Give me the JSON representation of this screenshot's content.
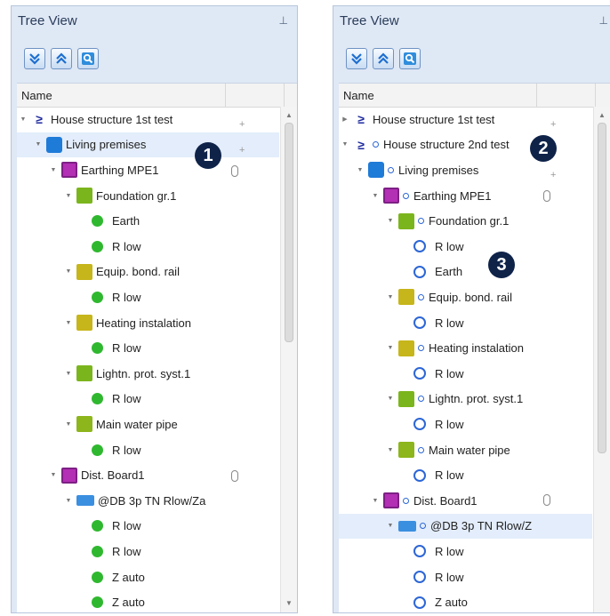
{
  "left": {
    "title": "Tree View",
    "pin": "📌",
    "header": "Name",
    "badge": "1",
    "rows": [
      {
        "label": "House structure 1st test",
        "icon": "house-structure-icon",
        "depth": 0,
        "arrow": "▼"
      },
      {
        "label": "Living premises",
        "icon": "living-premises-icon",
        "depth": 1,
        "arrow": "▼",
        "selected": true
      },
      {
        "label": "Earthing MPE1",
        "icon": "earthing-icon",
        "depth": 2,
        "arrow": "▼"
      },
      {
        "label": "Foundation gr.1",
        "icon": "foundation-icon",
        "depth": 3,
        "arrow": "▼"
      },
      {
        "label": "Earth",
        "icon": "green-dot-icon",
        "depth": 4
      },
      {
        "label": "R low",
        "icon": "green-dot-icon",
        "depth": 4
      },
      {
        "label": "Equip. bond. rail",
        "icon": "bonding-icon",
        "depth": 3,
        "arrow": "▼"
      },
      {
        "label": "R low",
        "icon": "green-dot-icon",
        "depth": 4
      },
      {
        "label": "Heating instalation",
        "icon": "heating-icon",
        "depth": 3,
        "arrow": "▼"
      },
      {
        "label": "R low",
        "icon": "green-dot-icon",
        "depth": 4
      },
      {
        "label": "Lightn. prot. syst.1",
        "icon": "lightning-icon",
        "depth": 3,
        "arrow": "▼"
      },
      {
        "label": "R low",
        "icon": "green-dot-icon",
        "depth": 4
      },
      {
        "label": "Main water pipe",
        "icon": "water-pipe-icon",
        "depth": 3,
        "arrow": "▼"
      },
      {
        "label": "R low",
        "icon": "green-dot-icon",
        "depth": 4
      },
      {
        "label": "Dist. Board1",
        "icon": "dist-board-icon",
        "depth": 2,
        "arrow": "▼"
      },
      {
        "label": "@DB 3p TN Rlow/Za",
        "icon": "db-icon",
        "depth": 3,
        "arrow": "▼"
      },
      {
        "label": "R low",
        "icon": "green-dot-icon",
        "depth": 4
      },
      {
        "label": "R low",
        "icon": "green-dot-icon",
        "depth": 4
      },
      {
        "label": "Z auto",
        "icon": "green-dot-icon",
        "depth": 4
      },
      {
        "label": "Z auto",
        "icon": "green-dot-icon",
        "depth": 4
      }
    ]
  },
  "right": {
    "title": "Tree View",
    "pin": "📌",
    "header": "Name",
    "badge2": "2",
    "badge3": "3",
    "rows": [
      {
        "label": "House structure 1st test",
        "icon": "house-structure-icon",
        "depth": 0,
        "arrow": "▶"
      },
      {
        "label": "House structure 2nd test",
        "icon": "house-structure-icon",
        "depth": 0,
        "arrow": "▼",
        "ring": true
      },
      {
        "label": "Living premises",
        "icon": "living-premises-icon",
        "depth": 1,
        "arrow": "▼",
        "ring": true
      },
      {
        "label": "Earthing MPE1",
        "icon": "earthing-icon",
        "depth": 2,
        "arrow": "▼",
        "ring": true
      },
      {
        "label": "Foundation gr.1",
        "icon": "foundation-icon",
        "depth": 3,
        "arrow": "▼",
        "ring": true
      },
      {
        "label": "R low",
        "icon": "blue-ring-icon",
        "depth": 4
      },
      {
        "label": "Earth",
        "icon": "blue-ring-icon",
        "depth": 4
      },
      {
        "label": "Equip. bond. rail",
        "icon": "bonding-icon",
        "depth": 3,
        "arrow": "▼",
        "ring": true
      },
      {
        "label": "R low",
        "icon": "blue-ring-icon",
        "depth": 4
      },
      {
        "label": "Heating instalation",
        "icon": "heating-icon",
        "depth": 3,
        "arrow": "▼",
        "ring": true
      },
      {
        "label": "R low",
        "icon": "blue-ring-icon",
        "depth": 4
      },
      {
        "label": "Lightn. prot. syst.1",
        "icon": "lightning-icon",
        "depth": 3,
        "arrow": "▼",
        "ring": true
      },
      {
        "label": "R low",
        "icon": "blue-ring-icon",
        "depth": 4
      },
      {
        "label": "Main water pipe",
        "icon": "water-pipe-icon",
        "depth": 3,
        "arrow": "▼",
        "ring": true
      },
      {
        "label": "R low",
        "icon": "blue-ring-icon",
        "depth": 4
      },
      {
        "label": "Dist. Board1",
        "icon": "dist-board-icon",
        "depth": 2,
        "arrow": "▼",
        "ring": true
      },
      {
        "label": "@DB 3p TN Rlow/Z",
        "icon": "db-icon",
        "depth": 3,
        "arrow": "▼",
        "ring": true,
        "selected": true
      },
      {
        "label": "R low",
        "icon": "blue-ring-icon",
        "depth": 4
      },
      {
        "label": "R low",
        "icon": "blue-ring-icon",
        "depth": 4
      },
      {
        "label": "Z auto",
        "icon": "blue-ring-icon",
        "depth": 4
      }
    ]
  },
  "toolbar": {
    "buttons": [
      "expand-all-icon",
      "collapse-all-icon",
      "search-icon"
    ]
  },
  "colors": {
    "panel_bg": "#dfe8f5",
    "selection": "#e3edfb",
    "green_status": "#2fb82f",
    "blue_ring": "#2c66d6",
    "badge": "#0f2349"
  }
}
